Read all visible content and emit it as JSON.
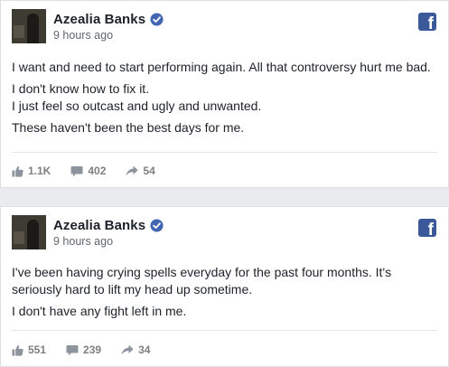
{
  "posts": [
    {
      "author": "Azealia Banks",
      "time": "9 hours ago",
      "paragraphs": [
        "I want and need to start performing again. All that controversy hurt me bad.",
        "I don't know how to fix it.",
        "I just feel so outcast and ugly and unwanted.",
        "These haven't been the best days for me."
      ],
      "likes": "1.1K",
      "comments": "402",
      "shares": "54"
    },
    {
      "author": "Azealia Banks",
      "time": "9 hours ago",
      "paragraphs": [
        "I've been having crying spells everyday for the past four months. It's",
        "seriously hard to lift my head up sometime.",
        "I don't have any fight left in me."
      ],
      "likes": "551",
      "comments": "239",
      "shares": "34"
    }
  ],
  "icons": {
    "avatar": "profile-photo",
    "verified": "verified-badge-icon",
    "brand": "facebook-logo-icon",
    "like": "thumbs-up-icon",
    "comment": "comment-bubble-icon",
    "share": "share-arrow-icon"
  },
  "colors": {
    "verified": "#4267b2",
    "brand": "#3b5998",
    "stat_text": "#7f7f7f"
  }
}
